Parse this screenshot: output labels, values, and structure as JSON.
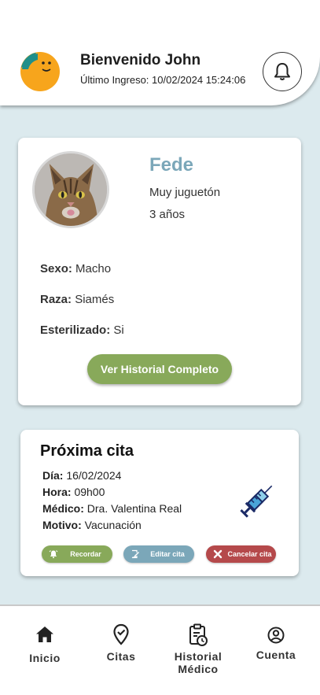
{
  "header": {
    "greeting": "Bienvenido John",
    "last_login": "Último Ingreso: 10/02/2024 15:24:06",
    "notification_icon": "bell-icon"
  },
  "pet": {
    "name": "Fede",
    "description": "Muy juguetón",
    "age": "3 años",
    "fields": [
      {
        "label": "Sexo:",
        "value": "Macho"
      },
      {
        "label": "Raza:",
        "value": "Siamés"
      },
      {
        "label": "Esterilizado:",
        "value": "Si"
      }
    ],
    "history_button": "Ver Historial Completo"
  },
  "appointment": {
    "title": "Próxima cita",
    "lines": [
      {
        "label": "Día:",
        "value": "16/02/2024"
      },
      {
        "label": "Hora:",
        "value": "09h00"
      },
      {
        "label": "Médico:",
        "value": "Dra. Valentina Real"
      },
      {
        "label": "Motivo:",
        "value": "Vacunación"
      }
    ],
    "actions": {
      "remind": "Recordar",
      "edit": "Editar cita",
      "cancel": "Cancelar cita"
    }
  },
  "nav": {
    "items": [
      {
        "label": "Inicio",
        "icon": "home-icon"
      },
      {
        "label": "Citas",
        "icon": "location-check-icon"
      },
      {
        "label": "Historial Médico",
        "icon": "clipboard-clock-icon"
      },
      {
        "label": "Cuenta",
        "icon": "account-icon"
      }
    ]
  },
  "colors": {
    "background": "#dceaee",
    "accent_green": "#88a95a",
    "accent_blue": "#7ba7b9",
    "accent_red": "#b5494b"
  }
}
